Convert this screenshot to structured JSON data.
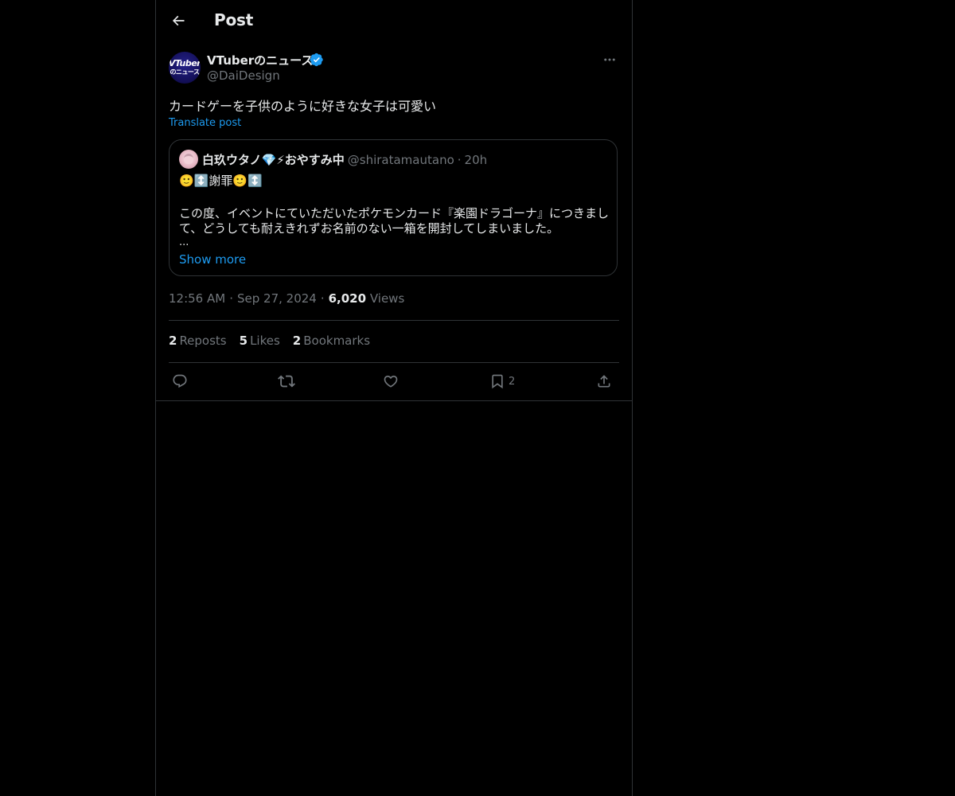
{
  "header": {
    "title": "Post",
    "back_icon": "arrow-left-icon"
  },
  "post": {
    "author": {
      "name": "VTuberのニュース",
      "handle": "@DaiDesign",
      "avatar_text_1": "VTuber",
      "avatar_text_2": "のニュース",
      "verified_icon": "verified-badge-icon",
      "verified_color": "#1d9bf0"
    },
    "more_icon": "more-dots-icon",
    "text": "カードゲーを子供のように好きな女子は可愛い",
    "translate_label": "Translate post",
    "quote": {
      "name": "白玖ウタノ💎⚡おやすみ中",
      "handle": "@shiratamautano",
      "separator": "·",
      "time": "20h",
      "line1": "🙂↕️謝罪🙂↕️",
      "line2": "この度、イベントにていただいたポケモンカード『楽園ドラゴーナ』につきまし",
      "line3": "て、どうしても耐えきれずお名前のない一箱を開封してしまいました。",
      "line4": "...",
      "show_more": "Show more"
    },
    "time": "12:56 AM",
    "date": "Sep 27, 2024",
    "separator": "·",
    "views_count": "6,020",
    "views_label": "Views",
    "stats": {
      "reposts_count": "2",
      "reposts_label": "Reposts",
      "likes_count": "5",
      "likes_label": "Likes",
      "bookmarks_count": "2",
      "bookmarks_label": "Bookmarks"
    },
    "actions": {
      "reply_icon": "reply-icon",
      "repost_icon": "repost-icon",
      "like_icon": "heart-icon",
      "bookmark_icon": "bookmark-icon",
      "bookmark_count": "2",
      "share_icon": "share-icon"
    }
  },
  "colors": {
    "background": "#000000",
    "text": "#e7e9ea",
    "secondary_text": "#71767b",
    "accent": "#1d9bf0",
    "border": "#2f3336"
  }
}
